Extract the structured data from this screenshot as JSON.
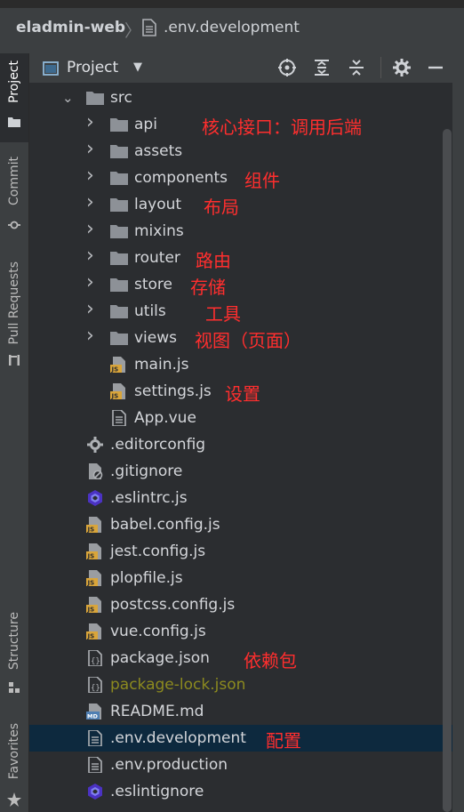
{
  "breadcrumb": {
    "project": "eladmin-web",
    "file": ".env.development"
  },
  "toolstrip": {
    "project": "Project",
    "commit": "Commit",
    "pull_requests": "Pull Requests",
    "structure": "Structure",
    "favorites": "Favorites"
  },
  "panel": {
    "title": "Project"
  },
  "tree": {
    "src": "src",
    "items": [
      {
        "label": "api",
        "icon": "folder-icon",
        "note": "核心接口：调用后端"
      },
      {
        "label": "assets",
        "icon": "folder-icon",
        "note": ""
      },
      {
        "label": "components",
        "icon": "folder-icon",
        "note": "组件"
      },
      {
        "label": "layout",
        "icon": "folder-icon",
        "note": "布局"
      },
      {
        "label": "mixins",
        "icon": "folder-icon",
        "note": ""
      },
      {
        "label": "router",
        "icon": "folder-icon",
        "note": "路由"
      },
      {
        "label": "store",
        "icon": "folder-icon",
        "note": "存储"
      },
      {
        "label": "utils",
        "icon": "folder-icon",
        "note": "工具"
      },
      {
        "label": "views",
        "icon": "folder-icon",
        "note": "视图（页面）"
      },
      {
        "label": "main.js",
        "icon": "js-file-icon",
        "note": ""
      },
      {
        "label": "settings.js",
        "icon": "js-file-icon",
        "note": "设置"
      },
      {
        "label": "App.vue",
        "icon": "text-file-icon",
        "note": ""
      }
    ],
    "root_files": [
      {
        "label": ".editorconfig",
        "icon": "gear-file-icon",
        "note": ""
      },
      {
        "label": ".gitignore",
        "icon": "ignore-file-icon",
        "note": ""
      },
      {
        "label": ".eslintrc.js",
        "icon": "eslint-icon",
        "note": ""
      },
      {
        "label": "babel.config.js",
        "icon": "js-file-icon",
        "note": ""
      },
      {
        "label": "jest.config.js",
        "icon": "js-file-icon",
        "note": ""
      },
      {
        "label": "plopfile.js",
        "icon": "js-file-icon",
        "note": ""
      },
      {
        "label": "postcss.config.js",
        "icon": "js-file-icon",
        "note": ""
      },
      {
        "label": "vue.config.js",
        "icon": "js-file-icon",
        "note": ""
      },
      {
        "label": "package.json",
        "icon": "json-file-icon",
        "note": "依赖包"
      },
      {
        "label": "package-lock.json",
        "icon": "json-file-icon",
        "note": ""
      },
      {
        "label": "README.md",
        "icon": "md-file-icon",
        "note": ""
      },
      {
        "label": ".env.development",
        "icon": "text-file-icon",
        "note": "配置"
      },
      {
        "label": ".env.production",
        "icon": "text-file-icon",
        "note": ""
      },
      {
        "label": ".eslintignore",
        "icon": "eslint-icon",
        "note": ""
      }
    ]
  },
  "colors": {
    "annotation": "#ff2e2e",
    "selection": "#0d293e",
    "js_badge": "#d9a53a"
  }
}
